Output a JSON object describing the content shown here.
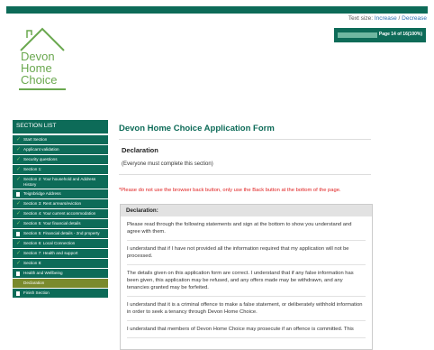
{
  "header": {
    "text_size_label": "Text size:",
    "increase": "Increase",
    "separator": " / ",
    "decrease": "Decrease"
  },
  "progress": {
    "text": "Page 14 of 16(100%)",
    "fraction": 0.88
  },
  "logo": {
    "line1": "Devon",
    "line2": "Home",
    "line3": "Choice"
  },
  "sidebar": {
    "title": "SECTION LIST",
    "items": [
      {
        "label": "Start Section",
        "icon": "check-icon"
      },
      {
        "label": "Applicant validation",
        "icon": "check-icon"
      },
      {
        "label": "Security questions",
        "icon": "check-icon"
      },
      {
        "label": "Section 1:",
        "icon": "check-icon"
      },
      {
        "label": "Section 2: Your household and Address History",
        "icon": "check-icon"
      },
      {
        "label": "Teignbridge Address",
        "icon": "document-icon"
      },
      {
        "label": "Section 3: Rent arrears/eviction",
        "icon": "check-icon"
      },
      {
        "label": "Section 4: Your current accommodation",
        "icon": "check-icon"
      },
      {
        "label": "Section 5: Your financial details",
        "icon": "check-icon"
      },
      {
        "label": "Section 5: Financial details - 2nd property",
        "icon": "document-icon"
      },
      {
        "label": "Section 6: Local Connection",
        "icon": "check-icon"
      },
      {
        "label": "Section 7: Health and support",
        "icon": "check-icon"
      },
      {
        "label": "Section 8:",
        "icon": "check-icon"
      },
      {
        "label": "Health and Wellbeing",
        "icon": "document-icon"
      },
      {
        "label": "Declaration",
        "icon": "none",
        "active": true
      },
      {
        "label": "Finish Section",
        "icon": "document-icon"
      }
    ]
  },
  "main": {
    "title": "Devon Home Choice Application Form",
    "section_heading": "Declaration",
    "section_sub": "(Everyone must complete this section)",
    "warning": "*Please do not use the browser back button, only use the Back button at the bottom of the page.",
    "box_title": "Declaration:",
    "paragraphs": [
      "Please read through the following statements and sign at the bottom to show you understand and agree with them.",
      "I understand that if I have not provided all the information required that my application will not be processed.",
      "The details given on this application form are correct. I understand that if any false information has been given, this application may be refused, and any offers made may be withdrawn, and any tenancies granted may be forfeited.",
      "I understand that it is a criminal offence to make a false statement, or deliberately withhold information in order to seek a tenancy through Devon Home Choice.",
      "I understand that members of Devon Home Choice may prosecute if an offence is committed. This"
    ]
  },
  "colors": {
    "brand": "#0d6b58",
    "active": "#7a8a2d",
    "warning": "#e02020",
    "logo_green": "#6aa84f"
  }
}
